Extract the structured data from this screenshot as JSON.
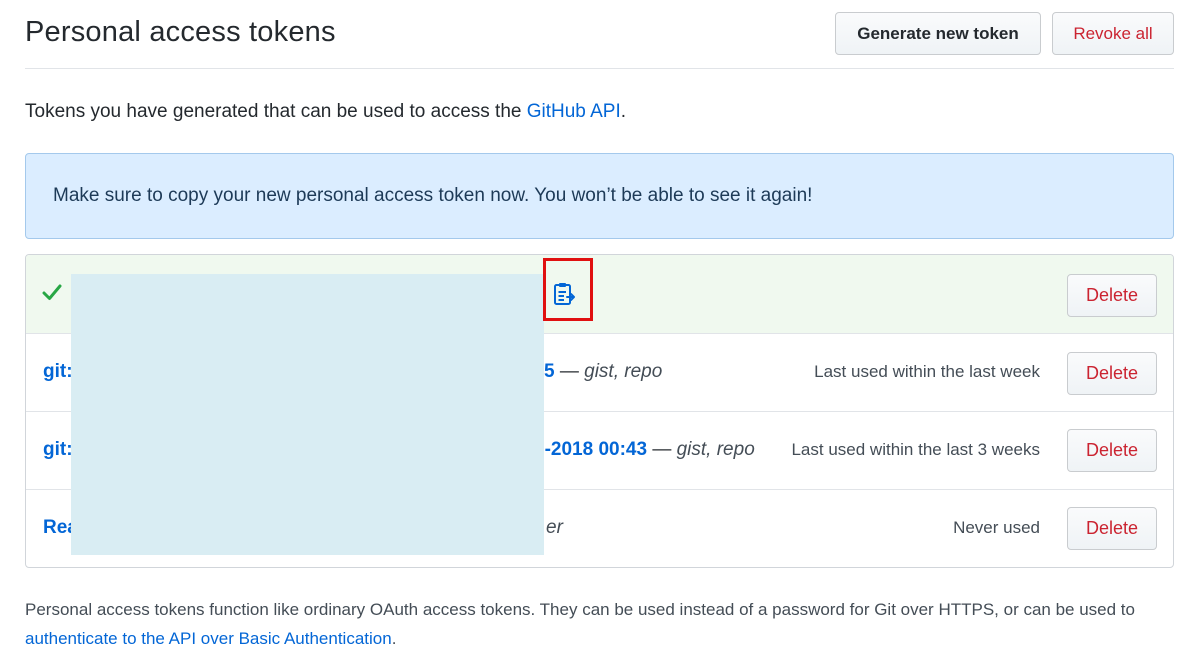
{
  "header": {
    "title": "Personal access tokens",
    "generate_label": "Generate new token",
    "revoke_label": "Revoke all"
  },
  "intro": {
    "text": "Tokens you have generated that can be used to access the ",
    "link": "GitHub API",
    "suffix": "."
  },
  "flash": {
    "message": "Make sure to copy your new personal access token now. You won’t be able to see it again!"
  },
  "tokens": [
    {
      "name": "",
      "delete_label": "Delete",
      "icons": [
        "check-icon",
        "clipboard-icon"
      ]
    },
    {
      "name": "git:",
      "date_partial": "5",
      "separator": " — ",
      "scopes": "gist, repo",
      "usage": "Last used within the last week",
      "delete_label": "Delete"
    },
    {
      "name": "git:",
      "date_partial": "5-2018 00:43",
      "separator": " — ",
      "scopes": "gist, repo",
      "usage": "Last used within the last 3 weeks",
      "delete_label": "Delete"
    },
    {
      "name": "Rea",
      "scopes_partial": "er",
      "usage": "Never used",
      "delete_label": "Delete"
    }
  ],
  "footer": {
    "text": "Personal access tokens function like ordinary OAuth access tokens. They can be used instead of a password for Git over HTTPS, or can be used to ",
    "link": "authenticate to the API over Basic Authentication",
    "suffix": "."
  },
  "colors": {
    "link": "#0366d6",
    "danger": "#cb2431",
    "success": "#28a745",
    "flash_bg": "#dbedff",
    "new_row_bg": "#f0f9ef",
    "highlight": "#e01010",
    "redaction": "#d9edf3"
  }
}
